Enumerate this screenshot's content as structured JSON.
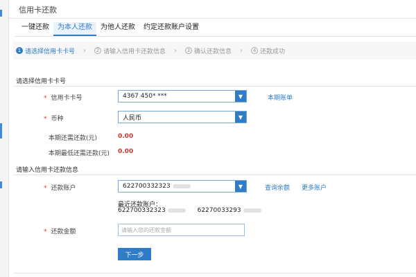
{
  "header": {
    "title": "信用卡还款"
  },
  "tabs": [
    {
      "label": "一键还款"
    },
    {
      "label": "为本人还款"
    },
    {
      "label": "为他人还款"
    },
    {
      "label": "约定还款账户设置"
    }
  ],
  "steps": [
    {
      "num": "1",
      "label": "请选择信用卡卡号"
    },
    {
      "num": "2",
      "label": "请输入信用卡还款信息"
    },
    {
      "num": "3",
      "label": "确认还款信息"
    },
    {
      "num": "4",
      "label": "还款成功"
    }
  ],
  "section1": {
    "title": "请选择信用卡卡号",
    "card_label": "信用卡卡号",
    "card_value": "4367 450* ***",
    "statement_link": "本期账单",
    "currency_label": "币种",
    "currency_value": "人民币",
    "due_label": "本期还需还款(元)",
    "due_value": "0.00",
    "min_label": "本期最低还需还款(元)",
    "min_value": "0.00"
  },
  "section2": {
    "title": "请输入信用卡还款信息",
    "account_label": "还款账户",
    "account_value": "622700332323",
    "balance_link": "查询余额",
    "more_link": "更多账户",
    "recent_label": "最近还款账户：",
    "recent_acct1": "622700332323",
    "recent_acct2": "62270033293",
    "amount_label": "还款金额",
    "amount_placeholder": "请输入您的还款金额",
    "next_button": "下一步"
  },
  "colors": {
    "accent": "#2f7cc7",
    "money": "#c0392b",
    "required": "#d33333"
  }
}
